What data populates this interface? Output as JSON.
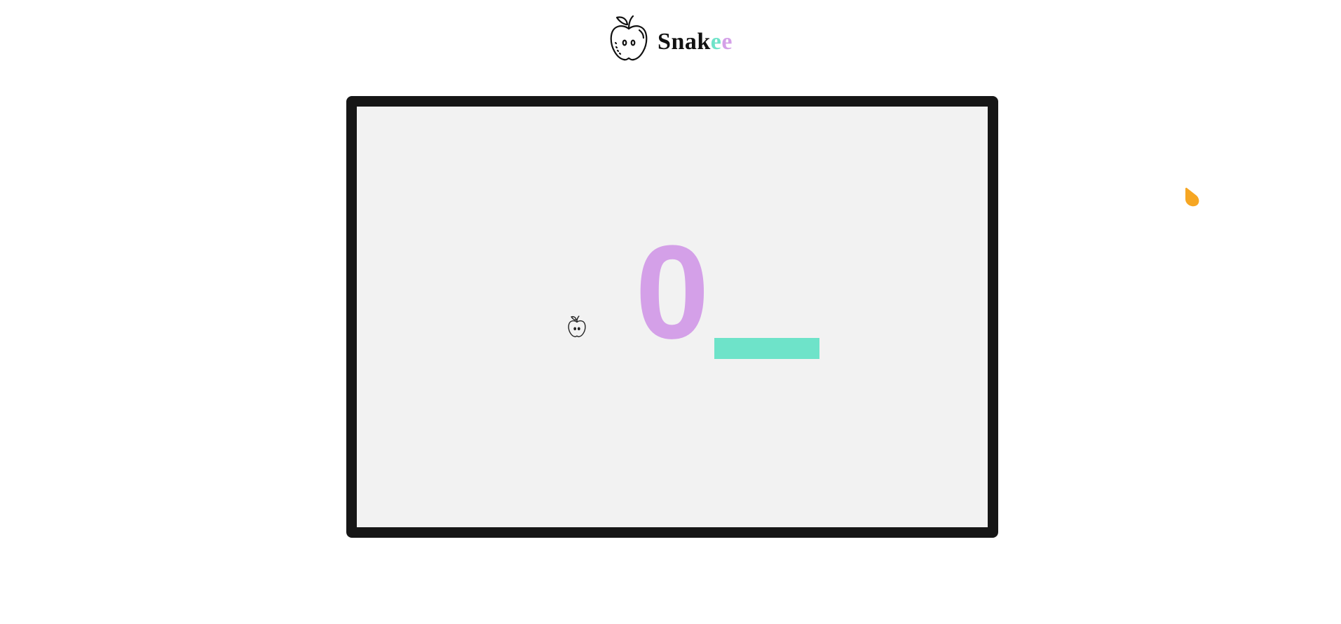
{
  "header": {
    "brand_prefix": "Snak",
    "brand_e1": "e",
    "brand_e2": "e",
    "logo_icon": "apple-icon"
  },
  "game": {
    "score": "0",
    "food_icon": "apple-icon",
    "colors": {
      "board_background": "#f2f2f2",
      "board_border": "#161616",
      "score_color": "#d4a0e8",
      "snake_color": "#6ee3c9",
      "cursor_color": "#f6a623"
    }
  }
}
